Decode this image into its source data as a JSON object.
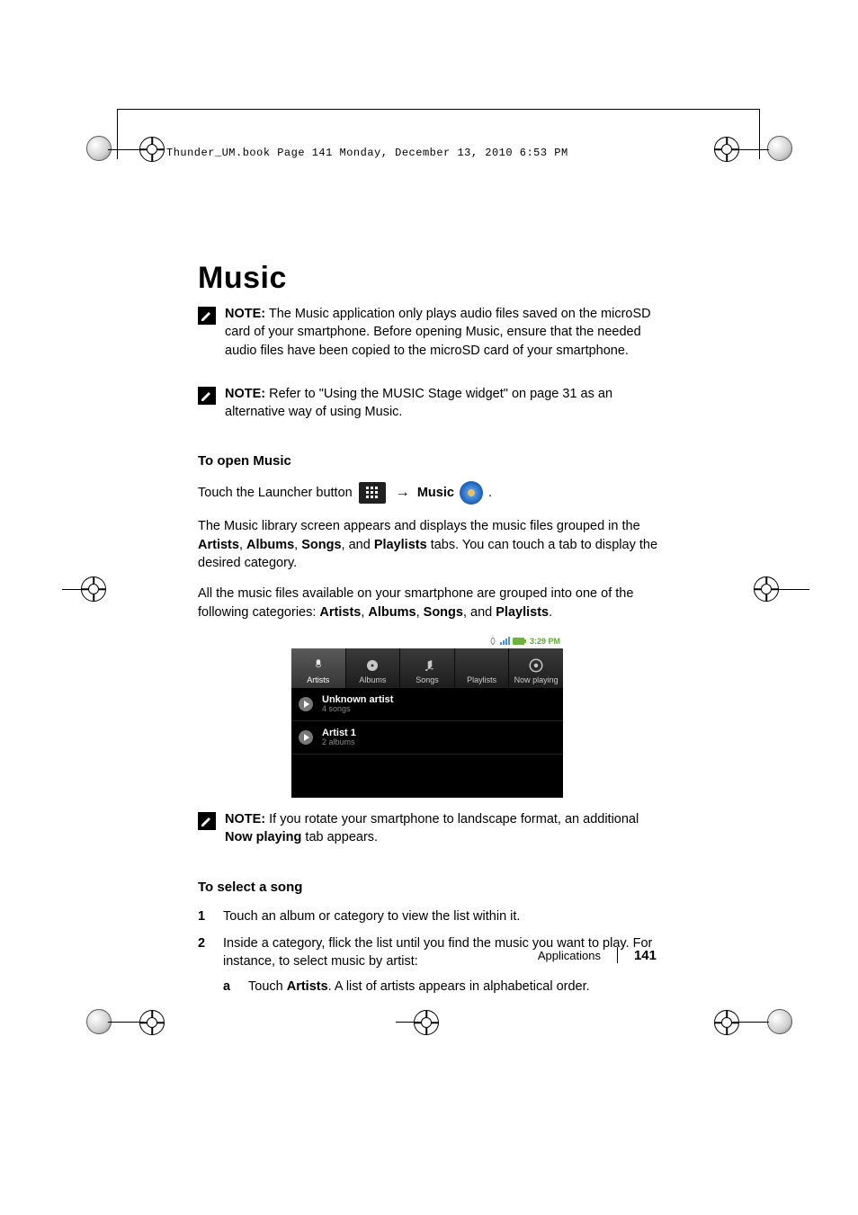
{
  "crop_header": "Thunder_UM.book  Page 141  Monday, December 13, 2010  6:53 PM",
  "title": "Music",
  "note1": {
    "prefix": "NOTE:",
    "text": " The Music application only plays audio files saved on the microSD card of your smartphone. Before opening Music, ensure that the needed audio files have been copied to the microSD card of your smartphone."
  },
  "note2": {
    "prefix": "NOTE:",
    "text": " Refer to \"Using the MUSIC Stage widget\" on page 31 as an alternative way of using Music."
  },
  "subhead_open": "To open Music",
  "launcher_line_pre": "Touch the Launcher button ",
  "launcher_arrow": "→",
  "launcher_music": "Music",
  "para_library_pre": "The Music library screen appears and displays the music files grouped in the ",
  "lib_tabs": {
    "a": "Artists",
    "b": "Albums",
    "c": "Songs",
    "d": "Playlists"
  },
  "para_library_post": " tabs. You can touch a tab to display the desired category.",
  "para_all_pre": "All the music files available on your smartphone are grouped into one of the following categories: ",
  "cats": {
    "a": "Artists",
    "b": "Albums",
    "c": "Songs",
    "d": "Playlists"
  },
  "phone": {
    "time": "3:29 PM",
    "tabs": [
      {
        "label": "Artists"
      },
      {
        "label": "Albums"
      },
      {
        "label": "Songs"
      },
      {
        "label": "Playlists"
      },
      {
        "label": "Now playing"
      }
    ],
    "rows": [
      {
        "main": "Unknown artist",
        "sub": "4 songs"
      },
      {
        "main": "Artist 1",
        "sub": "2 albums"
      }
    ]
  },
  "note3": {
    "prefix": "NOTE:",
    "text_pre": " If you rotate your smartphone to landscape format, an additional ",
    "bold": "Now playing",
    "text_post": " tab appears."
  },
  "subhead_select": "To select a song",
  "steps": {
    "s1": "Touch an album or category to view the list within it.",
    "s2": "Inside a category, flick the list until you find the music you want to play. For instance, to select music by artist:",
    "s2a_pre": "Touch ",
    "s2a_bold": "Artists",
    "s2a_post": ". A list of artists appears in alphabetical order."
  },
  "footer": {
    "section": "Applications",
    "page": "141"
  }
}
